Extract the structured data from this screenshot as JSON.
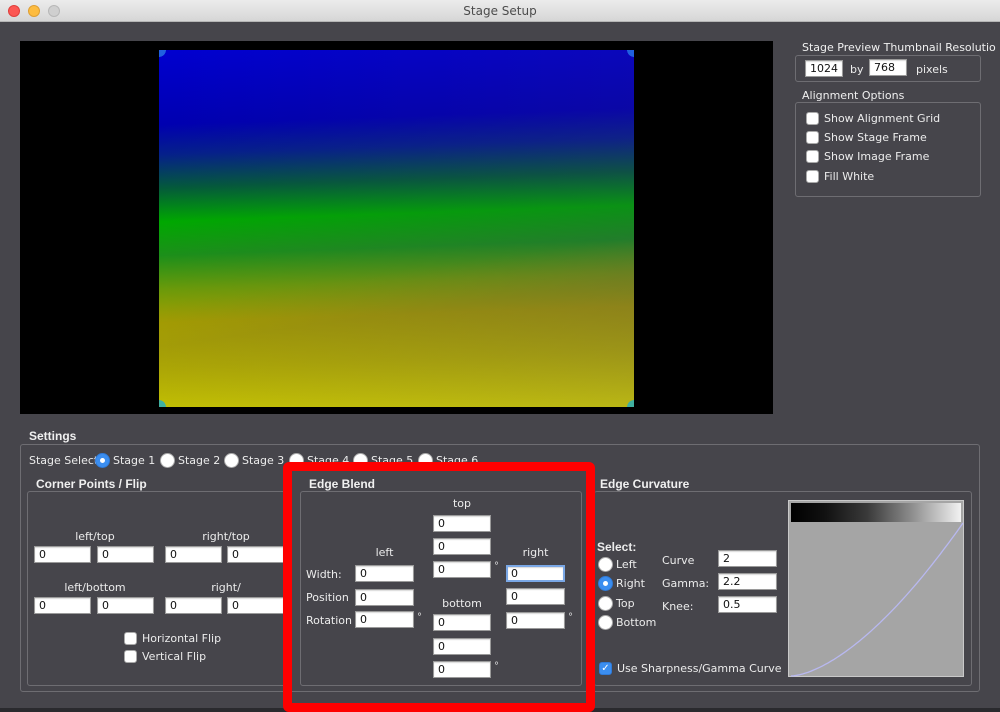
{
  "window": {
    "title": "Stage Setup",
    "buttons": [
      "close",
      "minimize",
      "maximize"
    ]
  },
  "preview": {
    "background": "#000000",
    "image_colors_top_to_bottom": [
      "#0000d0",
      "#00a800",
      "#d6d600"
    ]
  },
  "thumbnail": {
    "label": "Stage Preview Thumbnail Resolutio",
    "width_value": "1024",
    "by_label": "by",
    "height_value": "768",
    "unit_label": "pixels"
  },
  "alignment": {
    "label": "Alignment Options",
    "options": [
      {
        "label": "Show Alignment Grid",
        "checked": false
      },
      {
        "label": "Show Stage Frame",
        "checked": false
      },
      {
        "label": "Show Image Frame",
        "checked": false
      },
      {
        "label": "Fill White",
        "checked": false
      }
    ]
  },
  "settings": {
    "label": "Settings",
    "stage_select_label": "Stage Select:",
    "stages": [
      {
        "label": "Stage 1",
        "selected": true
      },
      {
        "label": "Stage 2",
        "selected": false
      },
      {
        "label": "Stage 3",
        "selected": false
      },
      {
        "label": "Stage 4",
        "selected": false
      },
      {
        "label": "Stage 5",
        "selected": false
      },
      {
        "label": "Stage 6",
        "selected": false
      }
    ]
  },
  "corner_points": {
    "label": "Corner Points / Flip",
    "left_top_label": "left/top",
    "right_top_label": "right/top",
    "left_bottom_label": "left/bottom",
    "right_bottom_label": "right/",
    "left_top": [
      "0",
      "0"
    ],
    "right_top": [
      "0",
      "0"
    ],
    "left_bottom": [
      "0",
      "0"
    ],
    "right_bottom": [
      "0",
      "0"
    ],
    "horizontal_flip_label": "Horizontal Flip",
    "horizontal_flip": false,
    "vertical_flip_label": "Vertical Flip",
    "vertical_flip": false
  },
  "edge_blend": {
    "label": "Edge Blend",
    "top_label": "top",
    "bottom_label": "bottom",
    "left_label": "left",
    "right_label": "right",
    "row_labels": {
      "width": "Width:",
      "position": "Position",
      "rotation": "Rotation"
    },
    "degree_symbol": "°",
    "top": {
      "width": "0",
      "position": "0",
      "rotation": "0"
    },
    "left": {
      "width": "0",
      "position": "0",
      "rotation": "0"
    },
    "right": {
      "width": "0",
      "position": "0",
      "rotation": "0"
    },
    "bottom": {
      "width": "0",
      "position": "0",
      "rotation": "0"
    }
  },
  "edge_curvature": {
    "label": "Edge Curvature",
    "select_label": "Select:",
    "edges": [
      {
        "label": "Left",
        "selected": false
      },
      {
        "label": "Right",
        "selected": true
      },
      {
        "label": "Top",
        "selected": false
      },
      {
        "label": "Bottom",
        "selected": false
      }
    ],
    "curve_label": "Curve",
    "curve_value": "2",
    "gamma_label": "Gamma:",
    "gamma_value": "2.2",
    "knee_label": "Knee:",
    "knee_value": "0.5",
    "use_curve_label": "Use Sharpness/Gamma Curve",
    "use_curve_checked": true,
    "curve_line_color": "#b8b8f0"
  },
  "annotation": {
    "highlight_color": "#ff0000",
    "highlighted_section": "Edge Blend"
  }
}
